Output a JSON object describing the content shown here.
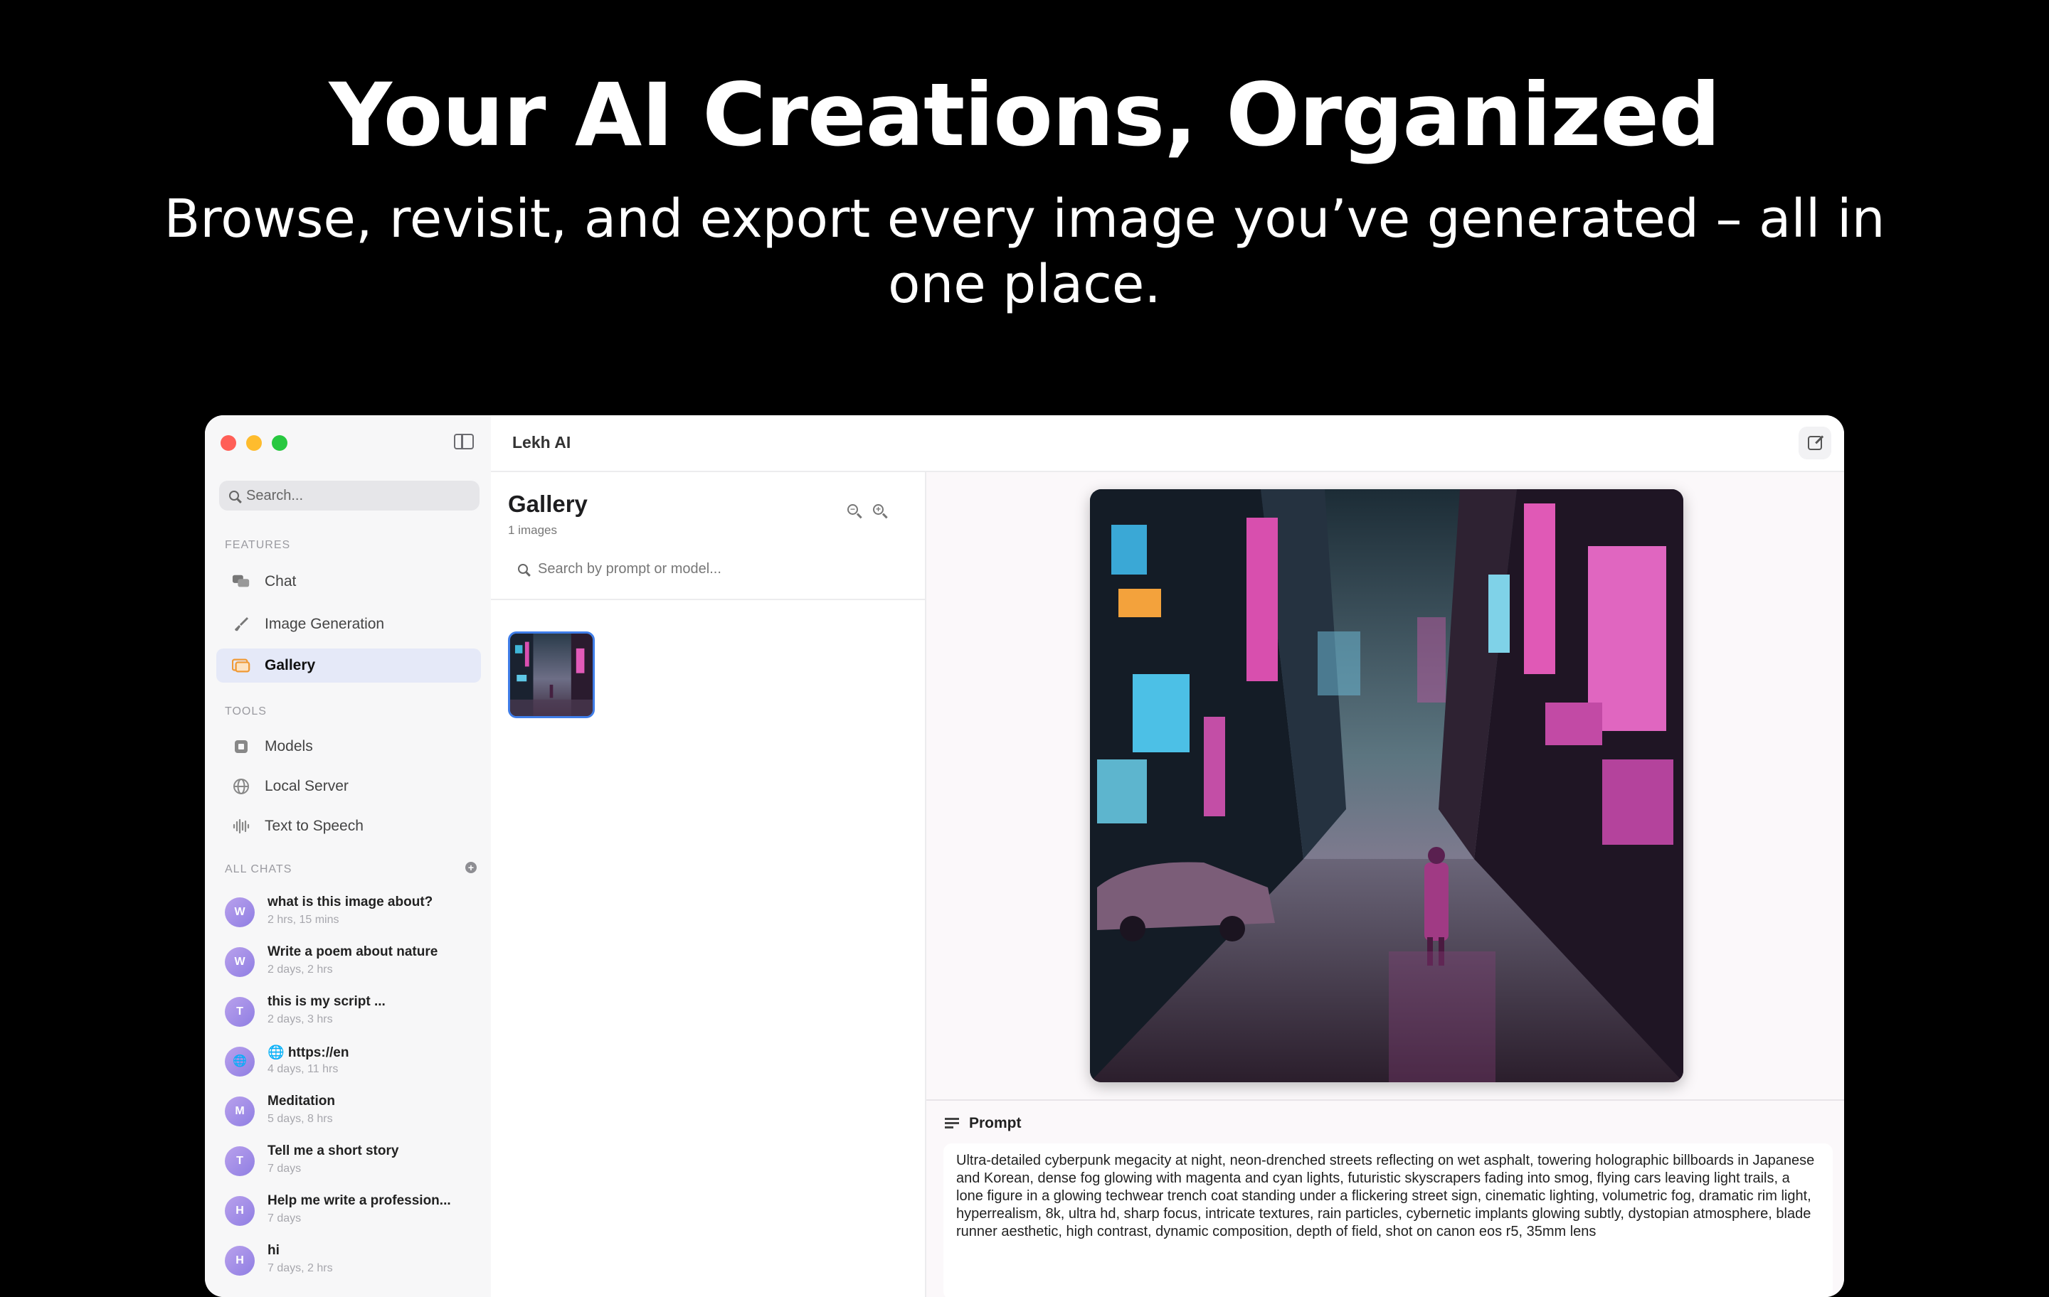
{
  "hero": {
    "title": "Your AI Creations, Organized",
    "subtitle": "Browse, revisit, and export every image you’ve generated – all in one place."
  },
  "app": {
    "title": "Lekh AI"
  },
  "sidebar": {
    "search_placeholder": "Search...",
    "features_label": "FEATURES",
    "features": [
      {
        "label": "Chat",
        "icon": "chat-bubbles-icon"
      },
      {
        "label": "Image Generation",
        "icon": "brush-icon"
      },
      {
        "label": "Gallery",
        "icon": "photo-stack-icon",
        "active": true
      }
    ],
    "tools_label": "TOOLS",
    "tools": [
      {
        "label": "Models",
        "icon": "cpu-icon"
      },
      {
        "label": "Local Server",
        "icon": "globe-icon"
      },
      {
        "label": "Text to Speech",
        "icon": "waveform-icon"
      }
    ],
    "chats_label": "ALL CHATS",
    "chats": [
      {
        "initial": "W",
        "title": "what is this image about?",
        "time": "2 hrs, 15 mins"
      },
      {
        "initial": "W",
        "title": "Write a poem about nature",
        "time": "2 days, 2 hrs"
      },
      {
        "initial": "T",
        "title": "this is my script ...",
        "time": "2 days, 3 hrs"
      },
      {
        "initial": "🌐",
        "title": "🌐 https://en",
        "time": "4 days, 11 hrs"
      },
      {
        "initial": "M",
        "title": "Meditation",
        "time": "5 days, 8 hrs"
      },
      {
        "initial": "T",
        "title": "Tell me a short story",
        "time": "7 days"
      },
      {
        "initial": "H",
        "title": "Help me write a profession...",
        "time": "7 days"
      },
      {
        "initial": "H",
        "title": "hi",
        "time": "7 days, 2 hrs"
      }
    ]
  },
  "gallery": {
    "title": "Gallery",
    "count": "1 images",
    "search_placeholder": "Search by prompt or model..."
  },
  "detail": {
    "prompt_label": "Prompt",
    "prompt_text": "Ultra-detailed cyberpunk megacity at night, neon-drenched streets reflecting on wet asphalt, towering holographic billboards in Japanese and Korean, dense fog glowing with magenta and cyan lights, futuristic skyscrapers fading into smog, flying cars leaving light trails, a lone figure in a glowing techwear trench coat standing under a flickering street sign, cinematic lighting, volumetric fog, dramatic rim light, hyperrealism, 8k, ultra hd, sharp focus, intricate textures, rain particles, cybernetic implants glowing subtly, dystopian atmosphere, blade runner aesthetic, high contrast, dynamic composition, depth of field, shot on canon eos r5, 35mm lens"
  }
}
